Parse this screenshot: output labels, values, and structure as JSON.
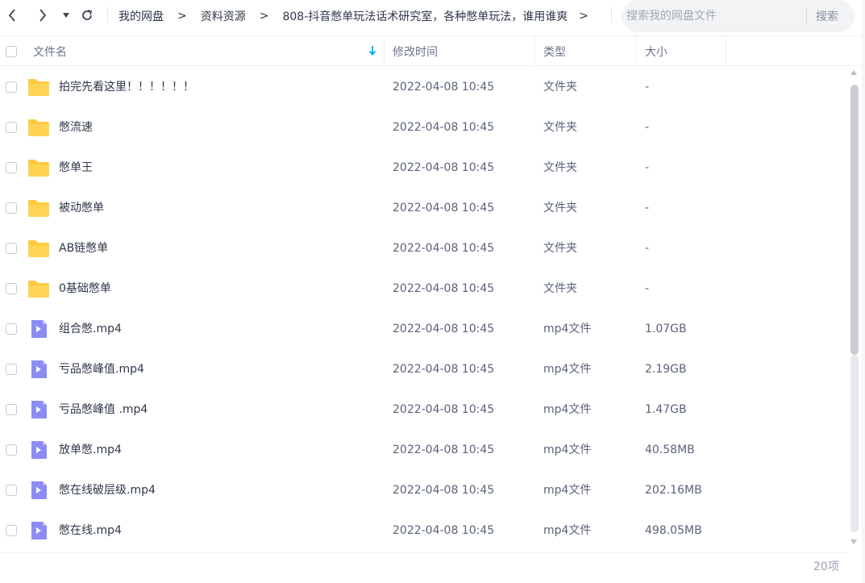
{
  "toolbar": {
    "back_label": "back",
    "forward_label": "forward",
    "dropdown_label": "history",
    "refresh_label": "refresh"
  },
  "breadcrumb": {
    "items": [
      "我的网盘",
      "资料资源",
      "808-抖音憋单玩法话术研究室，各种憋单玩法，谁用谁爽"
    ],
    "separator": ">"
  },
  "search": {
    "placeholder": "搜索我的网盘文件",
    "value": "",
    "button_label": "搜索"
  },
  "columns": {
    "name": "文件名",
    "modified": "修改时间",
    "type": "类型",
    "size": "大小"
  },
  "files": [
    {
      "name": "拍完先看这里！！！！！！",
      "modified": "2022-04-08 10:45",
      "type": "文件夹",
      "size": "-",
      "icon": "folder-icon"
    },
    {
      "name": "憋流速",
      "modified": "2022-04-08 10:45",
      "type": "文件夹",
      "size": "-",
      "icon": "folder-icon"
    },
    {
      "name": "憋单王",
      "modified": "2022-04-08 10:45",
      "type": "文件夹",
      "size": "-",
      "icon": "folder-icon"
    },
    {
      "name": "被动憋单",
      "modified": "2022-04-08 10:45",
      "type": "文件夹",
      "size": "-",
      "icon": "folder-icon"
    },
    {
      "name": "AB链憋单",
      "modified": "2022-04-08 10:45",
      "type": "文件夹",
      "size": "-",
      "icon": "folder-icon"
    },
    {
      "name": "0基础憋单",
      "modified": "2022-04-08 10:45",
      "type": "文件夹",
      "size": "-",
      "icon": "folder-icon"
    },
    {
      "name": "组合憋.mp4",
      "modified": "2022-04-08 10:45",
      "type": "mp4文件",
      "size": "1.07GB",
      "icon": "video-file-icon"
    },
    {
      "name": "亏品憋峰值.mp4",
      "modified": "2022-04-08 10:45",
      "type": "mp4文件",
      "size": "2.19GB",
      "icon": "video-file-icon"
    },
    {
      "name": "亏品憋峰值 .mp4",
      "modified": "2022-04-08 10:45",
      "type": "mp4文件",
      "size": "1.47GB",
      "icon": "video-file-icon"
    },
    {
      "name": "放单憋.mp4",
      "modified": "2022-04-08 10:45",
      "type": "mp4文件",
      "size": "40.58MB",
      "icon": "video-file-icon"
    },
    {
      "name": "憋在线破层级.mp4",
      "modified": "2022-04-08 10:45",
      "type": "mp4文件",
      "size": "202.16MB",
      "icon": "video-file-icon"
    },
    {
      "name": "憋在线.mp4",
      "modified": "2022-04-08 10:45",
      "type": "mp4文件",
      "size": "498.05MB",
      "icon": "video-file-icon"
    }
  ],
  "footer": {
    "count": "20项"
  },
  "colors": {
    "folder": "#ffc83d",
    "video": "#8c8cf5",
    "sort_arrow": "#06a7ff"
  }
}
